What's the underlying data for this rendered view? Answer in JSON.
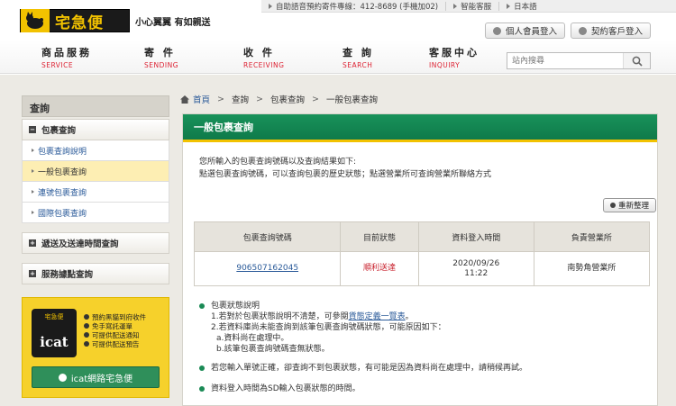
{
  "topbar": {
    "items": [
      "自助語音預約寄件專線：412-8689 (手機加02)",
      "智能客服",
      "日本語"
    ]
  },
  "brand": {
    "name": "宅急便",
    "slogan": "小心翼翼 有如親送"
  },
  "header_buttons": {
    "member_login": "個人會員登入",
    "contract_login": "契約客戶登入"
  },
  "nav": [
    {
      "zh": "商品服務",
      "en": "SERVICE"
    },
    {
      "zh": "寄 件",
      "en": "SENDING"
    },
    {
      "zh": "收 件",
      "en": "RECEIVING"
    },
    {
      "zh": "查 詢",
      "en": "SEARCH"
    },
    {
      "zh": "客服中心",
      "en": "INQUIRY"
    }
  ],
  "search": {
    "placeholder": "站內搜尋"
  },
  "sidebar": {
    "title": "查詢",
    "section1": "包裹查詢",
    "sub_items": [
      "包裹查詢說明",
      "一般包裹查詢",
      "連號包裹查詢",
      "國際包裹查詢"
    ],
    "section2": "遞送及送達時間查詢",
    "section3": "服務據點查詢"
  },
  "icat": {
    "logo_small": "宅急便",
    "logo_big": "icat",
    "features": [
      "預約黑貓到府收件",
      "免手寫託運單",
      "可提供配送通知",
      "可提供配送預告"
    ],
    "button": "icat網路宅急便"
  },
  "breadcrumb": [
    "首頁",
    "查詢",
    "包裹查詢",
    "一般包裹查詢"
  ],
  "panel": {
    "title": "一般包裹查詢",
    "intro_line1": "您所輸入的包裹查詢號碼以及查詢結果如下:",
    "intro_line2": "點選包裹查詢號碼，可以查詢包裹的歷史狀態；點選營業所可查詢營業所聯絡方式",
    "reset": "重新整理"
  },
  "table": {
    "headers": [
      "包裹查詢號碼",
      "目前狀態",
      "資料登入時間",
      "負責營業所"
    ],
    "row": {
      "tracking": "906507162045",
      "status": "順利送達",
      "date": "2020/09/26",
      "time": "11:22",
      "office": "南勢角營業所"
    }
  },
  "notes": {
    "n1_title": "包裹狀態說明",
    "n1_l1_pre": "1.若對於包裹狀態說明不清楚，可參閱",
    "n1_l1_link": "貨態定義一覽表",
    "n1_l1_post": "。",
    "n1_l2": "2.若資料庫尚未能查詢到該筆包裹查詢號碼狀態，可能原因如下：",
    "n1_l2a": "a.資料尚在處理中。",
    "n1_l2b": "b.該筆包裹查詢號碼查無狀態。",
    "n2": "若您輸入單號正確，卻查詢不到包裹狀態，有可能是因為資料尚在處理中，請稍候再試。",
    "n3": "資料登入時間為SD輸入包裹狀態的時間。"
  }
}
